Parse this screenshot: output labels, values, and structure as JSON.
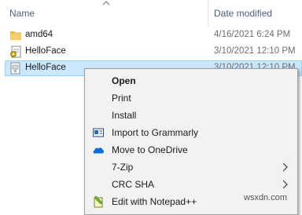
{
  "columns": {
    "name": "Name",
    "date_modified": "Date modified"
  },
  "files": [
    {
      "name": "amd64",
      "date": "4/16/2021 6:24 PM",
      "icon": "folder-icon",
      "selected": false
    },
    {
      "name": "HelloFace",
      "date": "3/10/2021 12:10 PM",
      "icon": "inf-file-icon",
      "selected": false
    },
    {
      "name": "HelloFace",
      "date": "3/10/2021 12:10 PM",
      "icon": "catalog-file-icon",
      "selected": true
    }
  ],
  "context_menu": {
    "items": [
      {
        "label": "Open",
        "bold": true
      },
      {
        "label": "Print"
      },
      {
        "label": "Install"
      },
      {
        "label": "Import to Grammarly",
        "icon": "grammarly-icon"
      },
      {
        "label": "Move to OneDrive",
        "icon": "onedrive-icon"
      },
      {
        "label": "7-Zip",
        "submenu": true
      },
      {
        "label": "CRC SHA",
        "submenu": true
      },
      {
        "label": "Edit with Notepad++",
        "icon": "notepadpp-icon"
      }
    ]
  },
  "watermark": "wsxdn.com",
  "colors": {
    "selection_bg": "#cce8ff",
    "selection_border": "#99d1ff",
    "menu_bg": "#f2f2f2",
    "folder": "#e8b74a",
    "onedrive": "#0f6cd2"
  }
}
